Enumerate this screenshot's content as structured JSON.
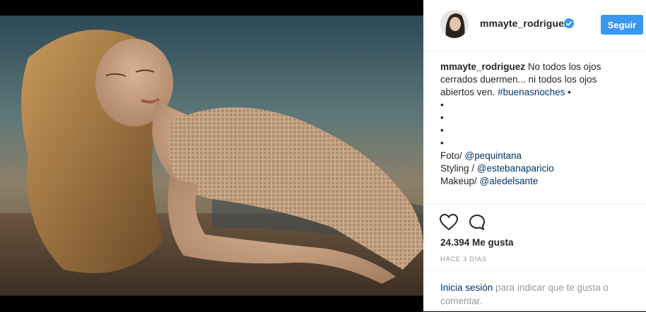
{
  "post": {
    "username": "mmayte_rodriguez",
    "follow_label": "Seguir",
    "caption": {
      "username": "mmayte_rodriguez",
      "text": "No todos los ojos cerrados duermen... ni todos los ojos abiertos ven.",
      "hashtag": "#buenasnoches",
      "trail": " •",
      "bullets": [
        "•",
        "•",
        "•",
        "•"
      ],
      "credits": [
        {
          "label": "Foto/ ",
          "handle": "@pequintana"
        },
        {
          "label": "Styling / ",
          "handle": "@estebanaparicio"
        },
        {
          "label": "Makeup/ ",
          "handle": "@aledelsante"
        }
      ]
    },
    "likes": "24.394 Me gusta",
    "time": "HACE 3 DÍAS",
    "login": {
      "link": "Inicia sesión",
      "text": " para indicar que te gusta o comentar."
    }
  },
  "icons": {
    "verified": "verified-badge-icon",
    "like": "heart-icon",
    "comment": "comment-icon"
  },
  "colors": {
    "accent": "#3897f0",
    "link": "#003569",
    "text": "#262626",
    "muted": "#999999"
  }
}
